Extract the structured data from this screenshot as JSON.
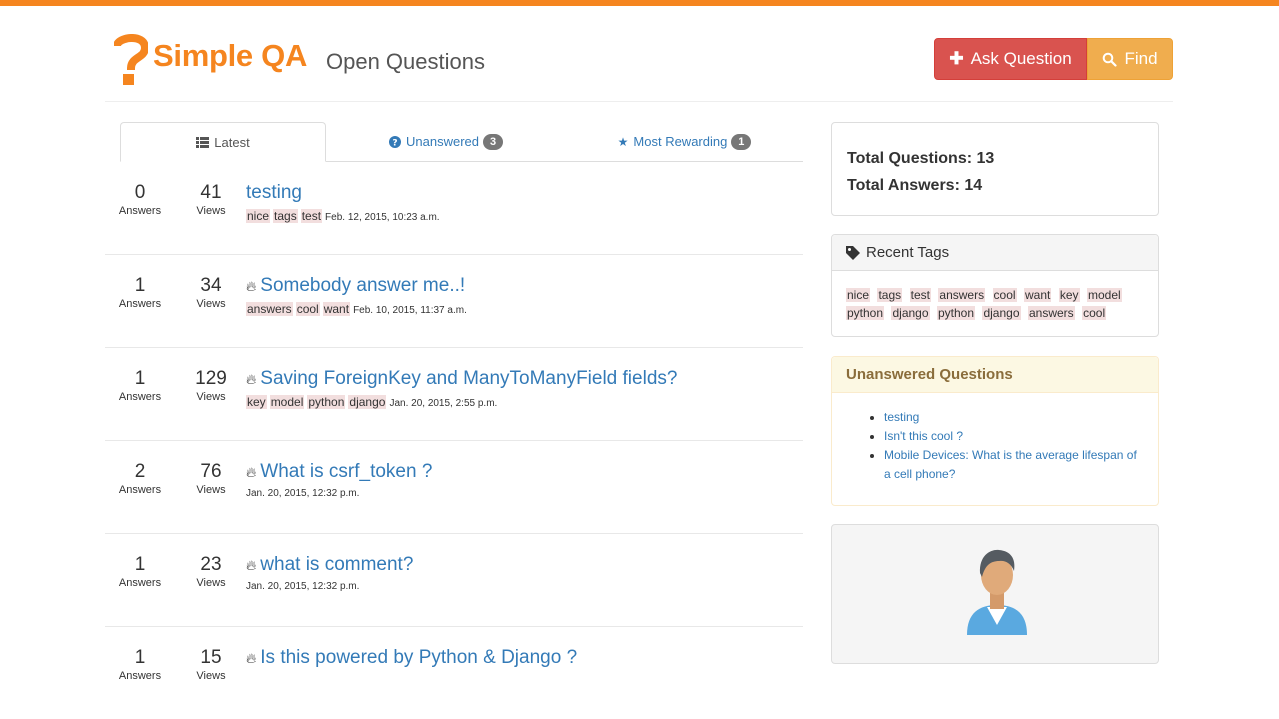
{
  "header": {
    "brand": "Simple QA",
    "subtitle": "Open Questions",
    "ask_button": "Ask Question",
    "find_button": "Find",
    "accent_color": "#f5851f"
  },
  "tabs": [
    {
      "label": "Latest",
      "icon": "list-icon",
      "active": true
    },
    {
      "label": "Unanswered",
      "icon": "question-circle-icon",
      "badge": "3"
    },
    {
      "label": "Most Rewarding",
      "icon": "star-icon",
      "badge": "1"
    }
  ],
  "labels": {
    "answers": "Answers",
    "views": "Views"
  },
  "questions": [
    {
      "answers": "0",
      "views": "41",
      "title": "testing",
      "hot": false,
      "tags": [
        "nice",
        "tags",
        "test"
      ],
      "date": "Feb. 12, 2015, 10:23 a.m."
    },
    {
      "answers": "1",
      "views": "34",
      "title": "Somebody answer me..!",
      "hot": true,
      "tags": [
        "answers",
        "cool",
        "want"
      ],
      "date": "Feb. 10, 2015, 11:37 a.m."
    },
    {
      "answers": "1",
      "views": "129",
      "title": "Saving ForeignKey and ManyToManyField fields?",
      "hot": true,
      "tags": [
        "key",
        "model",
        "python",
        "django"
      ],
      "date": "Jan. 20, 2015, 2:55 p.m."
    },
    {
      "answers": "2",
      "views": "76",
      "title": "What is csrf_token ?",
      "hot": true,
      "tags": [],
      "date": "Jan. 20, 2015, 12:32 p.m."
    },
    {
      "answers": "1",
      "views": "23",
      "title": "what is comment?",
      "hot": true,
      "tags": [],
      "date": "Jan. 20, 2015, 12:32 p.m."
    },
    {
      "answers": "1",
      "views": "15",
      "title": "Is this powered by Python & Django ?",
      "hot": true,
      "tags": [],
      "date": ""
    }
  ],
  "sidebar": {
    "total_questions": "Total Questions: 13",
    "total_answers": "Total Answers: 14",
    "recent_tags_title": "Recent Tags",
    "recent_tags": [
      "nice",
      "tags",
      "test",
      "answers",
      "cool",
      "want",
      "key",
      "model",
      "python",
      "django",
      "python",
      "django",
      "answers",
      "cool"
    ],
    "unanswered_title": "Unanswered Questions",
    "unanswered": [
      "testing",
      "Isn't this cool ?",
      "Mobile Devices: What is the average lifespan of a cell phone?"
    ]
  }
}
